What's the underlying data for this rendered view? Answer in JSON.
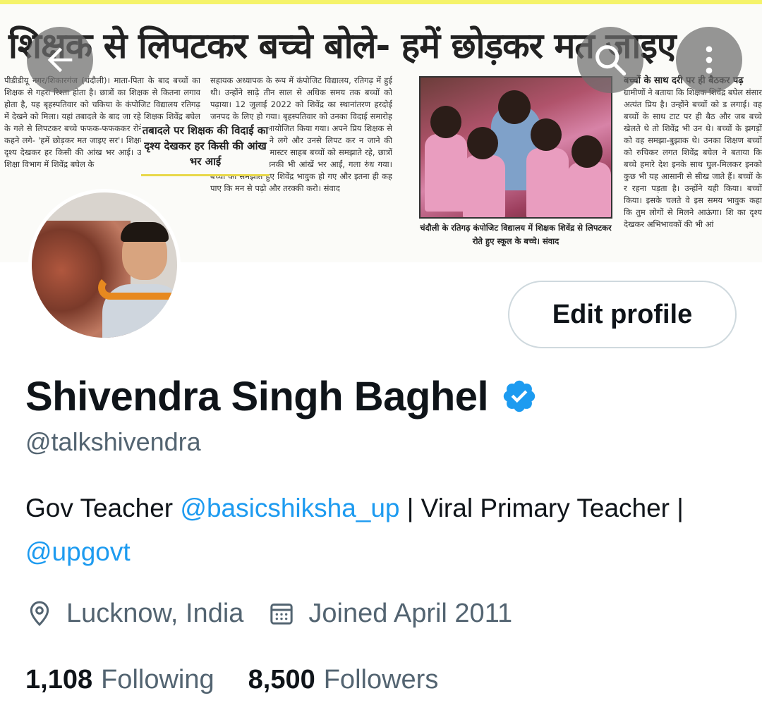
{
  "banner": {
    "headline": "शिक्षक से लिपटकर बच्चे बोले- हमें छोड़कर मत जाइए",
    "col1": "पीडीडीयू नगर/शिकारगंज (चंदौली)। माता-पिता के बाद बच्चों का शिक्षक से गहरा रिश्ता होता है। छात्रों का शिक्षक से कितना लगाव होता है, यह बृहस्पतिवार को चकिया के कंपोजिट विद्यालय रतिगढ़ में देखने को मिला। यहां तबादले के बाद जा रहे शिक्षक शिवेंद्र बघेल के गले से लिपटकर बच्चे फफक-फफककर रोने लगे। रोते हुए बच्चे कहने लगे- 'हमें छोड़कर मत जाइए सर'। शिक्षक की विदाई का यह दृश्य देखकर हर किसी की आंख भर आई। उत्तर प्रदेश के बेसिक शिक्षा विभाग में शिवेंद्र बघेल के",
    "col2": "सहायक अध्यापक के रूप में कंपोजिट विद्यालय, रतिगढ़ में हुई थी। उन्होंने साढ़े तीन साल से अधिक समय तक बच्चों को पढ़ाया। 12 जुलाई 2022 को शिवेंद्र का स्थानांतरण हरदोई जनपद के लिए हो गया। बृहस्पतिवार को उनका विदाई समारोह विद्यालय परिसर में आयोजित किया गया। अपने प्रिय शिक्षक से बिछड़ने पर बच्चे रोने लगे और उनसे लिपट कर न जाने की गुजारिश करने लगे। मास्टर साहब बच्चों को समझाते रहे, छात्रों का लगाव देखकर उनकी भी आंखें भर आईं, गला रुंध गया। बच्चों को समझाते हुए शिवेंद्र भावुक हो गए और इतना ही कह पाए कि मन से पढ़ो और तरक्की करो। संवाद",
    "pullquote": "तबादले पर शिक्षक की विदाई का दृश्य देखकर हर किसी की आंख भर आई",
    "photo_caption": "चंदौली के रतिगढ़ कंपोजिट विद्यालय में शिक्षक शिवेंद्र से लिपटकर रोते हुए स्कूल के बच्चे। संवाद",
    "col3_heading": "बच्चों के साथ दरी पर ही बैठकर पढ़",
    "col3": "ग्रामीणों ने बताया कि शिक्षक शिवेंद्र बघेल संसार अत्यंत प्रिय है। उन्होंने बच्चों को ड लगाई। वह बच्चों के साथ टाट पर ही बैठ और जब बच्चे खेलते थे तो शिवेंद्र भी उन थे। बच्चों के झगड़ों को वह समझा-बुझाक थे। उनका शिक्षण बच्चों को रुचिकर लगत शिवेंद्र बघेल ने बताया कि बच्चे हमारे देश इनके साथ घुल-मिलकर इनको कुछ भी यह आसानी से सीख जाते हैं। बच्चों के र रहना पड़ता है। उन्होंने यही किया। बच्चों किया। इसके चलते वे इस समय भावुक कहा कि तुम लोगों से मिलने आऊंगा। शि का दृश्य देखकर अभिभावकों की भी आं"
  },
  "actions": {
    "edit_profile_label": "Edit profile"
  },
  "profile": {
    "name": "Shivendra Singh Baghel",
    "verified": true,
    "handle": "@talkshivendra",
    "bio_text_1": "Gov Teacher ",
    "bio_mention_1": "@basicshiksha_up",
    "bio_text_2": " | Viral Primary Teacher | ",
    "bio_mention_2": "@upgovt",
    "location": "Lucknow, India",
    "joined": "Joined April 2011"
  },
  "stats": {
    "following_count": "1,108",
    "following_label": "Following",
    "followers_count": "8,500",
    "followers_label": "Followers"
  },
  "colors": {
    "accent": "#1d9bf0",
    "text_primary": "#0f1419",
    "text_secondary": "#536471",
    "border": "#cfd9de"
  },
  "icons": {
    "back": "arrow-left-icon",
    "search": "search-icon",
    "more": "more-vertical-icon",
    "verified": "verified-badge-icon",
    "location": "location-pin-icon",
    "calendar": "calendar-icon"
  }
}
